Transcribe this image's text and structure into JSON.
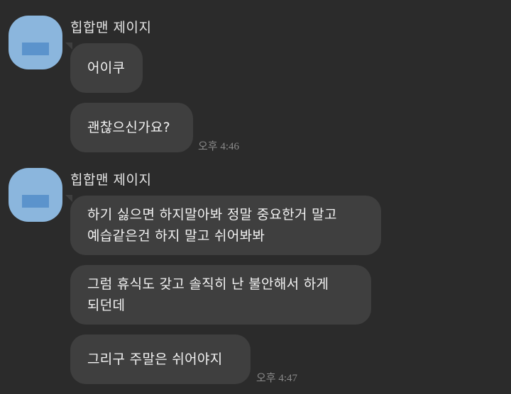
{
  "conversation": {
    "groups": [
      {
        "sender": "힙합맨 제이지",
        "messages": [
          "어이쿠",
          "괜찮으신가요?"
        ],
        "time": "오후 4:46"
      },
      {
        "sender": "힙합맨 제이지",
        "messages": [
          "하기 싫으면 하지말아봐 정말 중요한거 말고\n예습같은건 하지 말고 쉬어봐봐",
          "그럼 휴식도 갖고 솔직히 난 불안해서 하게\n되던데",
          "그리구 주말은 쉬어야지"
        ],
        "time": "오후 4:47"
      }
    ]
  },
  "colors": {
    "background": "#2b2b2b",
    "bubble": "#3f3f3f",
    "avatar": "#8bb6dd",
    "avatar_block": "#5b93cc",
    "text": "#f2f2f2",
    "timestamp": "#8a8a8a"
  }
}
